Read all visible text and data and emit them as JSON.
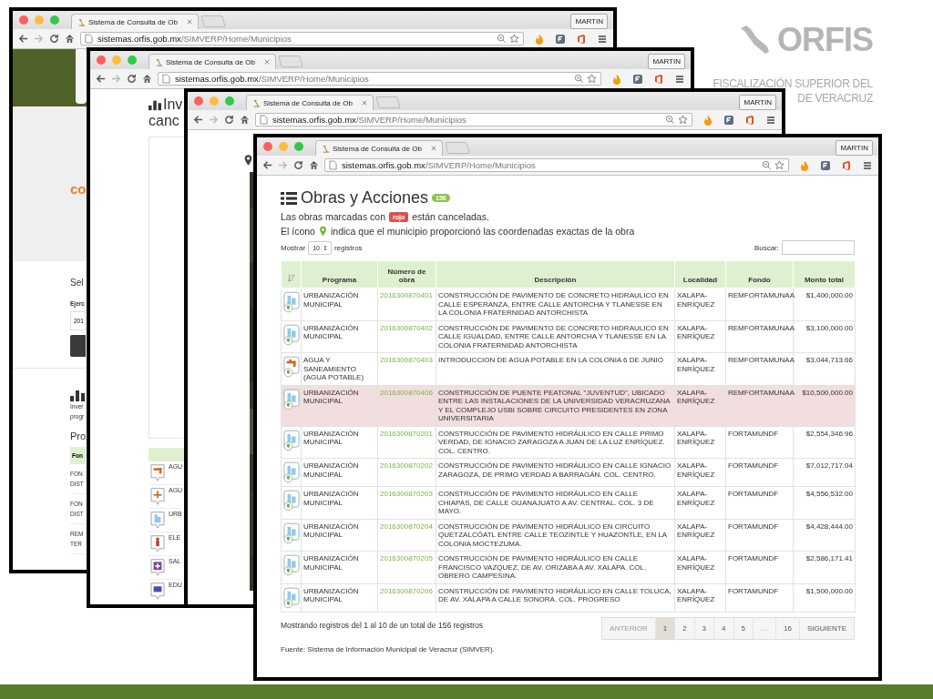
{
  "brand": {
    "logo": "ORFIS",
    "tagline": [
      "FISCALIZACIÓN SUPERIOR DEL",
      "DE VERACRUZ"
    ]
  },
  "windows": [
    {
      "kind": "home",
      "tab_title": "Sistema de Consulta de Ob",
      "user": "MARTIN",
      "url_host": "sistemas.orfis.gob.mx",
      "url_path": "/SIMVERP/Home/Municipios",
      "content": {
        "logo": "co",
        "heading": "Sel",
        "field_label": "Ejerc",
        "field_value": "201",
        "section_lines": [
          "Inver",
          "progr"
        ],
        "subheading": "Pro",
        "table_header": "Fon",
        "rows": [
          [
            "FON",
            "DIST"
          ],
          [
            "FON",
            "DIST"
          ],
          [
            "REM",
            "TER"
          ]
        ]
      }
    },
    {
      "kind": "chart",
      "tab_title": "Sistema de Consulta de Ob",
      "user": "MARTIN",
      "url_host": "sistemas.orfis.gob.mx",
      "url_path": "/SIMVERP/Home/Municipios",
      "content": {
        "heading_lines": [
          "Inv",
          "canc"
        ],
        "rows": [
          {
            "kind": "tap",
            "text": "AGU"
          },
          {
            "kind": "tap2",
            "text": "AGU"
          },
          {
            "kind": "building",
            "text": "URB"
          },
          {
            "kind": "person",
            "text": "ELE"
          },
          {
            "kind": "health",
            "text": "SAL"
          },
          {
            "kind": "school",
            "text": "EDU"
          }
        ]
      }
    },
    {
      "kind": "map",
      "tab_title": "Sistema de Consulta de Ob",
      "user": "MARTIN",
      "url_host": "sistemas.orfis.gob.mx",
      "url_path": "/SIMVERP/Home/Municipios"
    },
    {
      "kind": "table",
      "tab_title": "Sistema de Consulta de Ob",
      "user": "MARTIN",
      "url_host": "sistemas.orfis.gob.mx",
      "url_path": "/SIMVERP/Home/Municipios",
      "content": {
        "title": "Obras y Acciones",
        "count": "156",
        "notice_before": "Las obras marcadas con",
        "notice_badge": "rojo",
        "notice_after": "están canceladas.",
        "pin_before": "El ícono",
        "pin_after": "indica que el municipio proporcionó las coordenadas exactas de la obra",
        "show_label": "Mostrar",
        "page_size": "10",
        "show_suffix": "registros",
        "search_label": "Buscar:",
        "columns": [
          "Programa",
          "Número de obra",
          "Descripción",
          "Localidad",
          "Fondo",
          "Monto total"
        ],
        "rows": [
          {
            "kind": "building",
            "cancelled": false,
            "programa": "URBANIZACIÓN MUNICIPAL",
            "numero": "2016300870401",
            "descripcion": "CONSTRUCCIÓN DE PAVIMENTO DE CONCRETO HIDRAULICO EN CALLE ESPERANZA, ENTRE CALLE ANTORCHA Y TLANESSE EN LA COLONIA FRATERNIDAD ANTORCHISTA",
            "localidad": "XALAPA-ENRÍQUEZ",
            "fondo": "REMFORTAMUNAA",
            "monto": "$1,400,000.00"
          },
          {
            "kind": "building",
            "cancelled": false,
            "programa": "URBANIZACIÓN MUNICIPAL",
            "numero": "2016300870402",
            "descripcion": "CONSTRUCCIÓN DE PAVIMENTO DE CONCRETO HIDRAULICO EN CALLE IGUALDAD, ENTRE CALLE ANTORCHA Y TLANESSE EN LA COLONIA FRATERNIDAD ANTORCHISTA",
            "localidad": "XALAPA-ENRÍQUEZ",
            "fondo": "REMFORTAMUNAA",
            "monto": "$3,100,000.00"
          },
          {
            "kind": "tap",
            "cancelled": false,
            "programa": "AGUA Y SANEAMIENTO (AGUA POTABLE)",
            "numero": "2016300870403",
            "descripcion": "INTRODUCCION DE AGUA POTABLE EN LA COLONIA 6 DE JUNIO",
            "localidad": "XALAPA-ENRÍQUEZ",
            "fondo": "REMFORTAMUNAA",
            "monto": "$3,044,713.66"
          },
          {
            "kind": "building",
            "cancelled": true,
            "programa": "URBANIZACIÓN MUNICIPAL",
            "numero": "2016300870406",
            "descripcion": "CONSTRUCCIÓN DE PUENTE PEATONAL \"JUVENTUD\", UBICADO ENTRE LAS INSTALACIONES DE LA UNIVERSIDAD VERACRUZANA Y EL COMPLEJO USBI SOBRE CIRCUITO PRESIDENTES EN ZONA UNIVERSITARIA",
            "localidad": "XALAPA-ENRÍQUEZ",
            "fondo": "REMFORTAMUNAA",
            "monto": "$10,500,000.00"
          },
          {
            "kind": "building",
            "cancelled": false,
            "programa": "URBANIZACIÓN MUNICIPAL",
            "numero": "2016300870201",
            "descripcion": "CONSTRUCCIÓN DE PAVIMENTO HIDRÁULICO EN CALLE PRIMO VERDAD, DE IGNACIO ZARAGOZA A JUAN DE LA LUZ ENRÍQUEZ. COL. CENTRO.",
            "localidad": "XALAPA-ENRÍQUEZ",
            "fondo": "FORTAMUNDF",
            "monto": "$2,554,346.96"
          },
          {
            "kind": "building",
            "cancelled": false,
            "programa": "URBANIZACIÓN MUNICIPAL",
            "numero": "2016300870202",
            "descripcion": "CONSTRUCCIÓN DE PAVIMENTO HIDRÁULICO EN CALLE IGNACIO ZARAGOZA, DE PRIMO VERDAD A BARRAGÁN. COL. CENTRO.",
            "localidad": "XALAPA-ENRÍQUEZ",
            "fondo": "FORTAMUNDF",
            "monto": "$7,012,717.04"
          },
          {
            "kind": "building",
            "cancelled": false,
            "programa": "URBANIZACIÓN MUNICIPAL",
            "numero": "2016300870203",
            "descripcion": "CONSTRUCCIÓN DE PAVIMENTO HIDRÁULICO EN CALLE CHIAPAS, DE CALLE GUANAJUATO A AV. CENTRAL. COL. 3 DE MAYO.",
            "localidad": "XALAPA-ENRÍQUEZ",
            "fondo": "FORTAMUNDF",
            "monto": "$4,556,532.00"
          },
          {
            "kind": "building",
            "cancelled": false,
            "programa": "URBANIZACIÓN MUNICIPAL",
            "numero": "2016300870204",
            "descripcion": "CONSTRUCCIÓN DE PAVIMENTO HIDRÁULICO EN CIRCUITO QUETZALCÓATL ENTRE CALLE TEOZINTLE Y HUAZONTLE, EN LA COLONIA MOCTEZUMA.",
            "localidad": "XALAPA-ENRÍQUEZ",
            "fondo": "FORTAMUNDF",
            "monto": "$4,428,444.00"
          },
          {
            "kind": "building",
            "cancelled": false,
            "programa": "URBANIZACIÓN MUNICIPAL",
            "numero": "2016300870205",
            "descripcion": "CONSTRUCCIÓN DE PAVIMENTO HIDRÁULICO EN CALLE FRANCISCO VAZQUEZ, DE AV. ORIZABA A AV. XALAPA. COL. OBRERO CAMPESINA.",
            "localidad": "XALAPA-ENRÍQUEZ",
            "fondo": "FORTAMUNDF",
            "monto": "$2,586,171.41"
          },
          {
            "kind": "building",
            "cancelled": false,
            "programa": "URBANIZACIÓN MUNICIPAL",
            "numero": "2016300870206",
            "descripcion": "CONSTRUCCIÓN DE PAVIMENTO HIDRÁULICO EN CALLE TOLUCA, DE AV. XALAPA A CALLE SONORA. COL. PROGRESO",
            "localidad": "XALAPA-ENRÍQUEZ",
            "fondo": "FORTAMUNDF",
            "monto": "$1,500,000.00"
          }
        ],
        "summary": "Mostrando registros del 1 al 10 de un total de 156 registros",
        "pages": [
          {
            "label": "ANTERIOR",
            "selected": false,
            "disabled": true
          },
          {
            "label": "1",
            "selected": true,
            "disabled": false
          },
          {
            "label": "2",
            "selected": false,
            "disabled": false
          },
          {
            "label": "3",
            "selected": false,
            "disabled": false
          },
          {
            "label": "4",
            "selected": false,
            "disabled": false
          },
          {
            "label": "5",
            "selected": false,
            "disabled": false
          },
          {
            "label": "…",
            "selected": false,
            "disabled": true
          },
          {
            "label": "16",
            "selected": false,
            "disabled": false
          },
          {
            "label": "SIGUIENTE",
            "selected": false,
            "disabled": false
          }
        ],
        "source": "Fuente: Sistema de Información Municipal de Veracruz (SIMVER)."
      }
    }
  ]
}
